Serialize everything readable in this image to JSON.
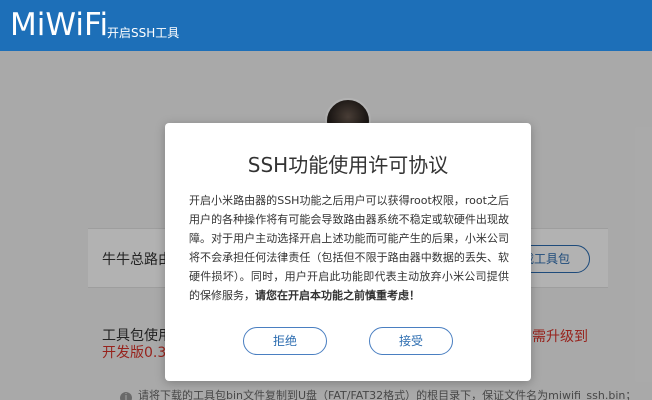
{
  "header": {
    "logo": "MiWiFi",
    "title": "开启SSH工具"
  },
  "device": {
    "name": "牛牛总路由",
    "download_label": "下载工具包"
  },
  "tool_info": {
    "line1": "工具包使用",
    "line2": "开发版0.3.8",
    "warning": "需升级到"
  },
  "note": {
    "icon": "info-icon",
    "text": "请将下载的工具包bin文件复制到U盘（FAT/FAT32格式）的根目录下，保证文件名为miwifi_ssh.bin；"
  },
  "modal": {
    "title": "SSH功能使用许可协议",
    "body": "开启小米路由器的SSH功能之后用户可以获得root权限，root之后用户的各种操作将有可能会导致路由器系统不稳定或软硬件出现故障。对于用户主动选择开启上述功能而可能产生的后果，小米公司将不会承担任何法律责任（包括但不限于路由器中数据的丢失、软硬件损坏）。同时，用户开启此功能即代表主动放弃小米公司提供的保修服务，",
    "body_emphasis": "请您在开启本功能之前慎重考虑！",
    "reject_label": "拒绝",
    "accept_label": "接受"
  },
  "colors": {
    "header_bg": "#1d6fb8",
    "accent": "#2b6cb0",
    "warning": "#d8332a"
  }
}
